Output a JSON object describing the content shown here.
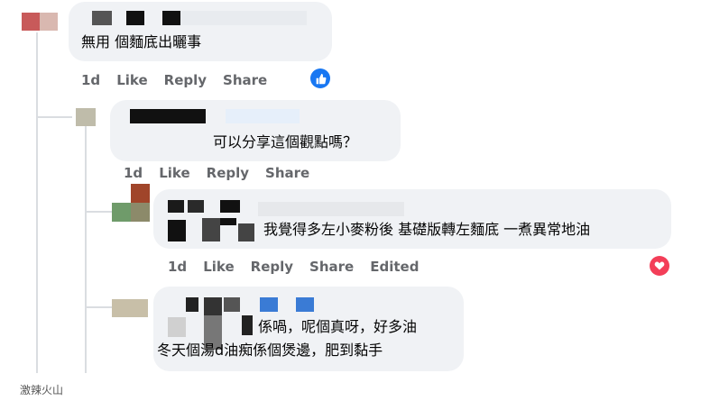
{
  "comments": [
    {
      "text_lines": [
        "無用 個麵底出曬事"
      ],
      "actions": {
        "time": "1d",
        "like": "Like",
        "reply": "Reply",
        "share": "Share"
      },
      "reaction": "like-icon",
      "colors": {
        "reaction": "#1877f2"
      }
    },
    {
      "text_lines": [
        "可以分享這個觀點嗎？"
      ],
      "actions": {
        "time": "1d",
        "like": "Like",
        "reply": "Reply",
        "share": "Share"
      }
    },
    {
      "text_lines": [
        "我覺得多左小麥粉後 基礎版轉左麵底 一煮異常地油"
      ],
      "actions": {
        "time": "1d",
        "like": "Like",
        "reply": "Reply",
        "share": "Share",
        "edited": "Edited"
      },
      "reaction": "love-icon",
      "colors": {
        "reaction": "#f33e58"
      }
    },
    {
      "text_lines": [
        "係喎，呢個真呀，好多油",
        "冬天個湯d油痴係個煲邊，肥到黏手"
      ]
    }
  ],
  "watermark": "激辣火山"
}
